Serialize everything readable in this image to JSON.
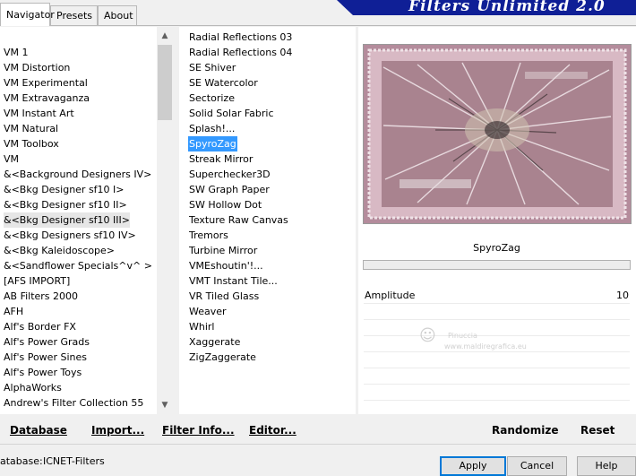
{
  "tabs": [
    "Navigator",
    "Presets",
    "About"
  ],
  "banner_title": "Filters Unlimited 2.0",
  "categories": [
    "VM 1",
    "VM Distortion",
    "VM Experimental",
    "VM Extravaganza",
    "VM Instant Art",
    "VM Natural",
    "VM Toolbox",
    "VM",
    "&<Background Designers IV>",
    "&<Bkg Designer sf10 I>",
    "&<Bkg Designer sf10 II>",
    "&<Bkg Designer sf10 III>",
    "&<Bkg Designers sf10 IV>",
    "&<Bkg Kaleidoscope>",
    "&<Sandflower Specials^v^ >",
    "[AFS IMPORT]",
    "AB Filters 2000",
    "AFH",
    "Alf's Border FX",
    "Alf's Power Grads",
    "Alf's Power Sines",
    "Alf's Power Toys",
    "AlphaWorks",
    "Andrew's Filter Collection 55"
  ],
  "selected_category": "&<Bkg Designer sf10 III>",
  "filters": [
    "Radial Reflections 03",
    "Radial Reflections 04",
    "SE Shiver",
    "SE Watercolor",
    "Sectorize",
    "Solid Solar Fabric",
    "Splash!...",
    "SpyroZag",
    "Streak Mirror",
    "Superchecker3D",
    "SW Graph Paper",
    "SW Hollow Dot",
    "Texture Raw Canvas",
    "Tremors",
    "Turbine Mirror",
    "VMEshoutin'!...",
    "VMT Instant Tile...",
    "VR Tiled Glass",
    "Weaver",
    "Whirl",
    "Xaggerate",
    "ZigZaggerate"
  ],
  "selected_filter": "SpyroZag",
  "filter_name": "SpyroZag",
  "params": [
    {
      "label": "Amplitude",
      "value": "10"
    }
  ],
  "watermark_line1": "Pinuccia",
  "watermark_line2": "www.maldiregrafica.eu",
  "toolbar": {
    "database": "Database",
    "import": "Import...",
    "filter_info": "Filter Info...",
    "editor": "Editor...",
    "randomize": "Randomize",
    "reset": "Reset"
  },
  "status_label": "atabase:",
  "status_value": "ICNET-Filters",
  "dialog": {
    "apply": "Apply",
    "cancel": "Cancel",
    "help": "Help"
  },
  "colors": {
    "selection": "#3399ff",
    "banner": "#0f1f96",
    "preview": "#b48c9c"
  }
}
